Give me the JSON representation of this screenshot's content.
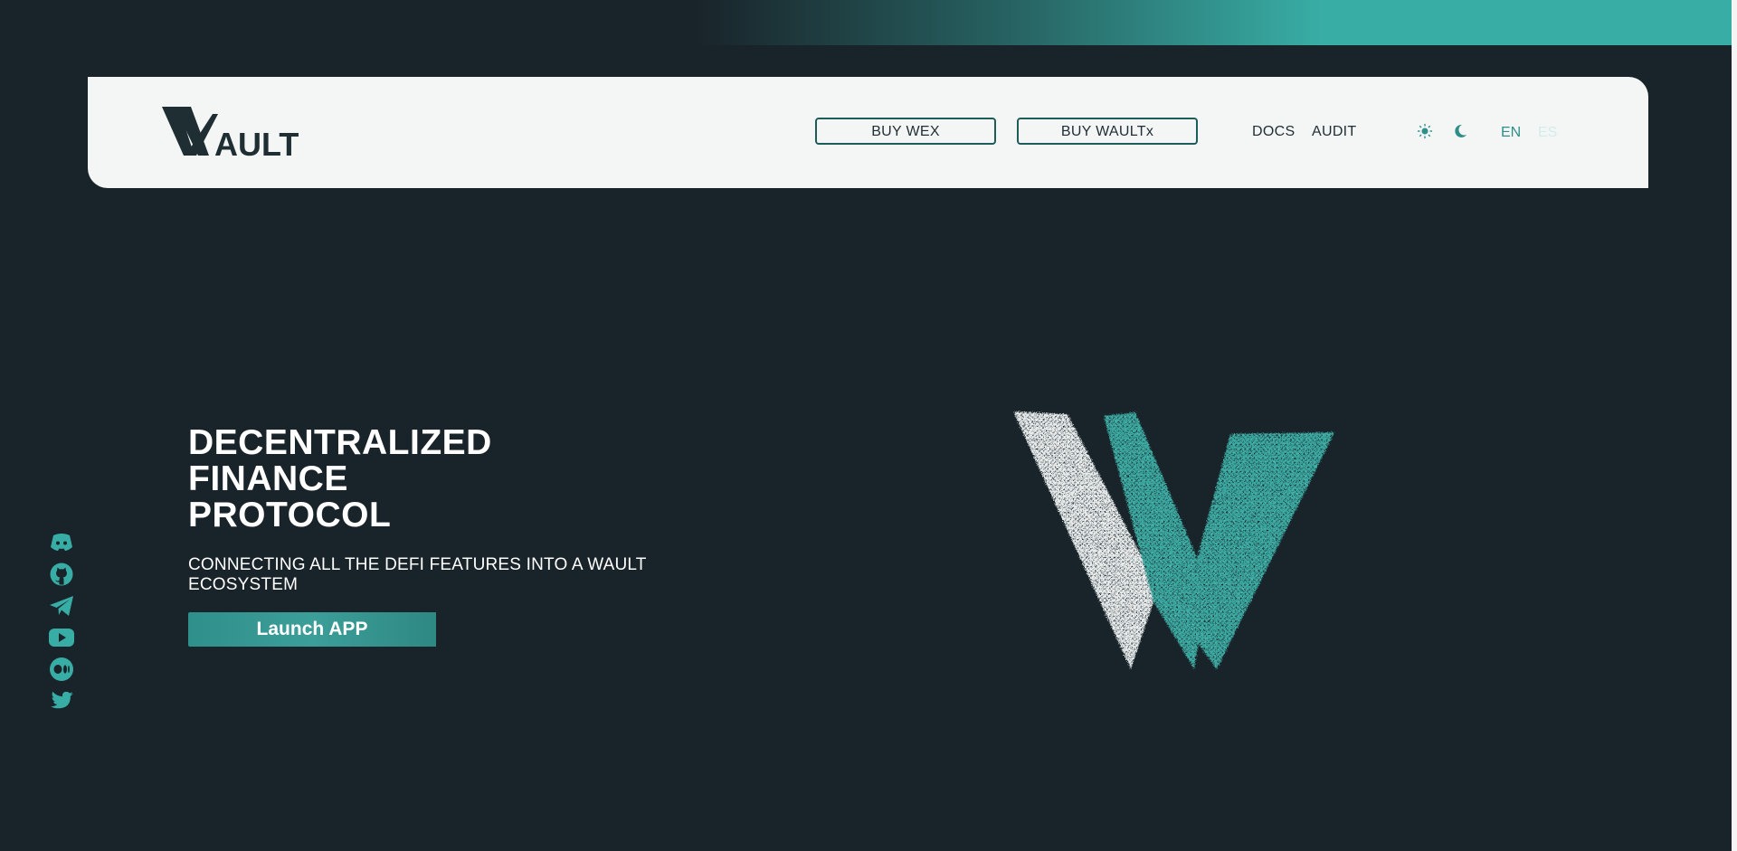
{
  "brand": {
    "logo_text": "WAULT",
    "accent_color": "#38ada5",
    "background_color": "#19242a",
    "navbar_color": "#f4f6f5"
  },
  "nav": {
    "buy_wex": "BUY WEX",
    "buy_waultx": "BUY WAULTx",
    "docs": "DOCS",
    "audit": "AUDIT",
    "theme_light_icon": "sun-icon",
    "theme_dark_icon": "moon-icon",
    "lang_en": "EN",
    "lang_es": "ES"
  },
  "hero": {
    "title_lines": [
      "DECENTRALIZED",
      "FINANCE",
      "PROTOCOL"
    ],
    "subtitle": "CONNECTING ALL THE DEFI FEATURES INTO A WAULT ECOSYSTEM",
    "cta_label": "Launch APP"
  },
  "socials": [
    {
      "name": "discord-icon"
    },
    {
      "name": "github-icon"
    },
    {
      "name": "telegram-icon"
    },
    {
      "name": "youtube-icon"
    },
    {
      "name": "medium-icon"
    },
    {
      "name": "twitter-icon"
    }
  ]
}
